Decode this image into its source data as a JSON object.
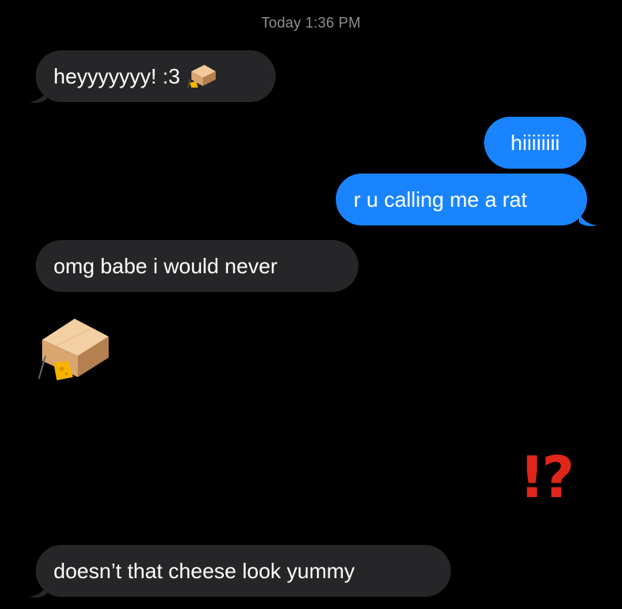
{
  "conversation": {
    "timestamp": "Today 1:36 PM",
    "messages": [
      {
        "side": "incoming",
        "text": "heyyyyyyy! :3",
        "has_emoji": "mousetrap-icon"
      },
      {
        "side": "outgoing",
        "text": "hiiiiiiii"
      },
      {
        "side": "outgoing",
        "text": "r u calling me a rat"
      },
      {
        "side": "incoming",
        "text": "omg babe i would never"
      },
      {
        "side": "incoming",
        "emoji": "mousetrap-icon"
      },
      {
        "side": "outgoing",
        "emoji": "interrobang-icon",
        "text": "⁉"
      },
      {
        "side": "incoming",
        "text": "doesn’t that cheese look yummy"
      }
    ]
  },
  "colors": {
    "background": "#000000",
    "incoming_bubble": "#262628",
    "outgoing_bubble": "#1a84ff",
    "timestamp": "#8e8e93",
    "interrobang": "#e0261a"
  }
}
